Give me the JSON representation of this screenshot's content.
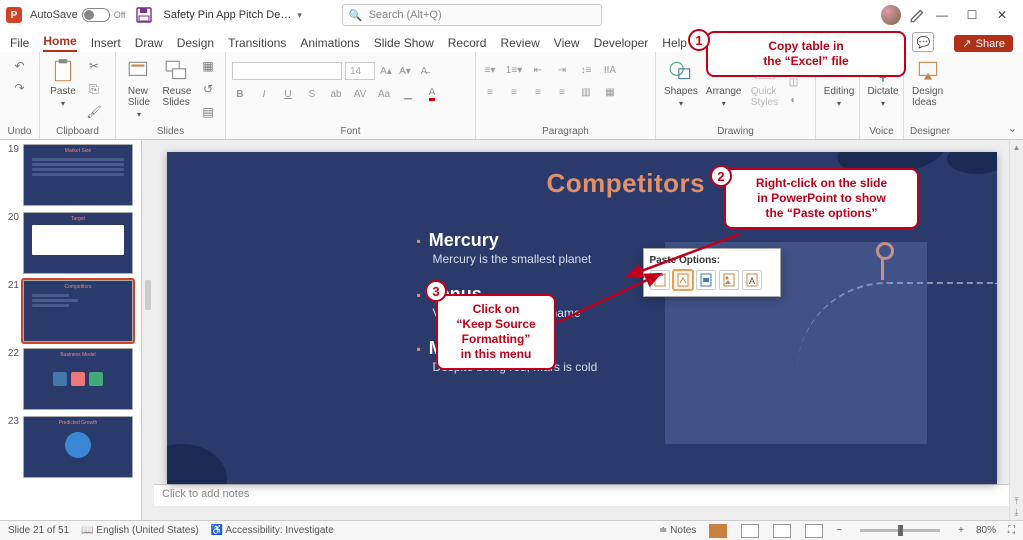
{
  "titlebar": {
    "autosave_label": "AutoSave",
    "autosave_state": "Off",
    "doc_name": "Safety Pin App Pitch De…",
    "search_placeholder": "Search (Alt+Q)"
  },
  "tabs": {
    "items": [
      "File",
      "Home",
      "Insert",
      "Draw",
      "Design",
      "Transitions",
      "Animations",
      "Slide Show",
      "Record",
      "Review",
      "View",
      "Developer",
      "Help"
    ],
    "active": "Home",
    "record_label": "Record",
    "share_label": "Share"
  },
  "ribbon": {
    "undo": {
      "label": "Undo"
    },
    "clipboard": {
      "label": "Clipboard",
      "paste": "Paste"
    },
    "slides": {
      "label": "Slides",
      "new": "New\nSlide",
      "reuse": "Reuse\nSlides"
    },
    "font": {
      "label": "Font",
      "size": "14"
    },
    "paragraph": {
      "label": "Paragraph"
    },
    "drawing": {
      "label": "Drawing",
      "shapes": "Shapes",
      "arrange": "Arrange",
      "quick": "Quick\nStyles"
    },
    "editing": {
      "label": "Editing",
      "btn": "Editing"
    },
    "voice": {
      "label": "Voice",
      "dictate": "Dictate"
    },
    "designer": {
      "label": "Designer",
      "ideas": "Design\nIdeas"
    }
  },
  "thumbs": {
    "items": [
      {
        "num": "19",
        "title": "Market Size"
      },
      {
        "num": "20",
        "title": "Target"
      },
      {
        "num": "21",
        "title": "Competitors",
        "active": true
      },
      {
        "num": "22",
        "title": "Business Model"
      },
      {
        "num": "23",
        "title": "Predicted Growth"
      }
    ]
  },
  "slide": {
    "title": "Competitors",
    "bullets": [
      {
        "h": "Mercury",
        "p": "Mercury is the smallest planet"
      },
      {
        "h": "Venus",
        "p": "Venus has a beautiful name"
      },
      {
        "h": "Mars",
        "p": "Despite being red, Mars is cold"
      }
    ],
    "paste_options_title": "Paste Options:"
  },
  "annotations": {
    "a1": "Copy table in\nthe “Excel” file",
    "a2": "Right-click on the slide\nin PowerPoint to show\nthe “Paste options”",
    "a3": "Click on\n“Keep Source\nFormatting”\nin this menu"
  },
  "notes": {
    "placeholder": "Click to add notes"
  },
  "status": {
    "slide": "Slide 21 of 51",
    "lang": "English (United States)",
    "access": "Accessibility: Investigate",
    "notes": "Notes",
    "zoom": "80%"
  }
}
